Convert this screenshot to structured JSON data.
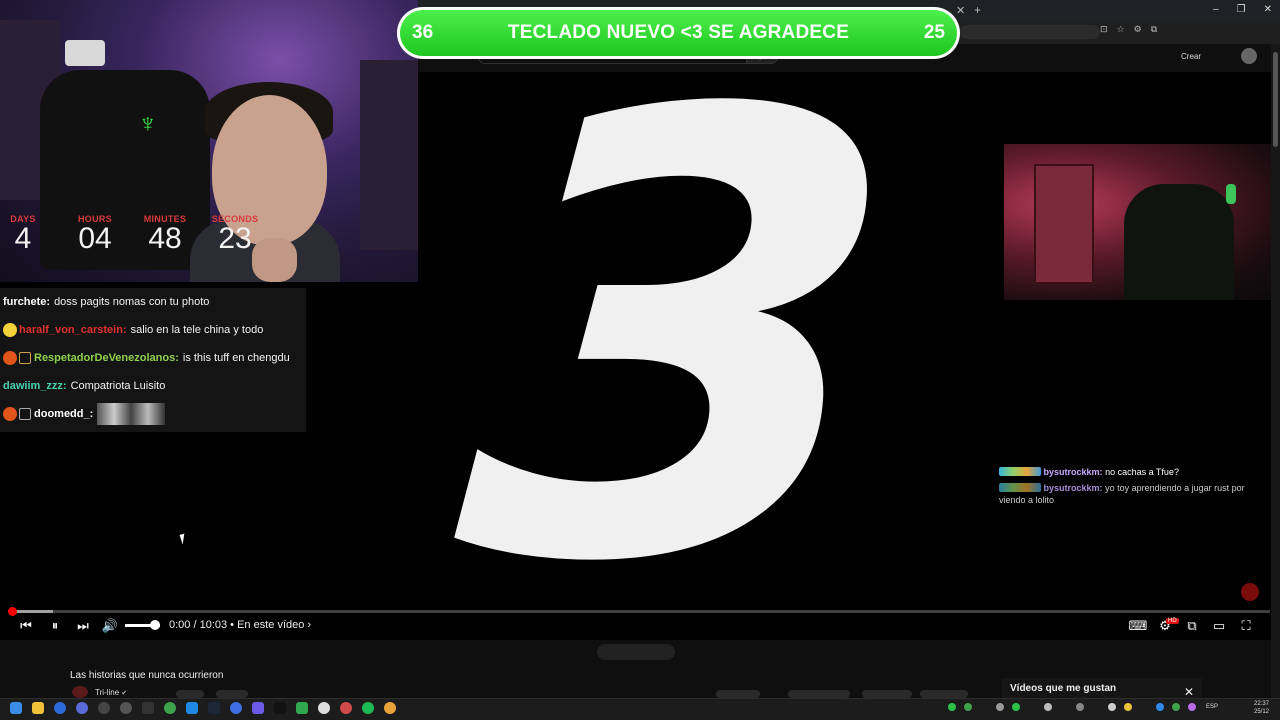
{
  "banner": {
    "left_number": "36",
    "text": "TECLADO NUEVO <3 SE AGRADECE",
    "right_number": "25"
  },
  "countdown": [
    {
      "label": "DAYS",
      "value": "4"
    },
    {
      "label": "HOURS",
      "value": "04"
    },
    {
      "label": "MINUTES",
      "value": "48"
    },
    {
      "label": "SECONDS",
      "value": "23"
    }
  ],
  "big_number": "3",
  "youtube": {
    "create_label": "Crear"
  },
  "chat_left": [
    {
      "user": "furchete:",
      "text": "doss pagits nomas con tu photo",
      "color": "#ffffff"
    },
    {
      "user": "haralf_von_carstein:",
      "text": "salio en la tele china y todo",
      "color": "#e03030"
    },
    {
      "user": "RespetadorDeVenezolanos:",
      "text": "is this tuff en chengdu",
      "color": "#8fd14a"
    },
    {
      "user": "dawiim_zzz:",
      "text": "Compatriota Luisito",
      "color": "#4ad1b0"
    },
    {
      "user": "doomedd_:",
      "text": "",
      "color": "#ffffff"
    }
  ],
  "chat_right": [
    {
      "user": "bysutrockkm:",
      "text": "no cachas a Tfue?"
    },
    {
      "user": "bysutrockkm:",
      "text": "yo toy aprendiendo a jugar rust por viendo a lolito"
    }
  ],
  "player": {
    "time": "0:00 / 10:03",
    "chapter": "• En este vídeo ›",
    "progress": 0.0,
    "buffered": 0.034,
    "volume": 0.85,
    "hd_badge": "HD"
  },
  "below": {
    "title": "Las historias que nunca ocurrieron",
    "channel": "Tri-line",
    "verified": "✔",
    "liked_label": "Vídeos que me gustan",
    "close_icon": "✕"
  },
  "taskbar": {
    "lang": "ESP",
    "time": "22:37",
    "date": "25/12"
  }
}
